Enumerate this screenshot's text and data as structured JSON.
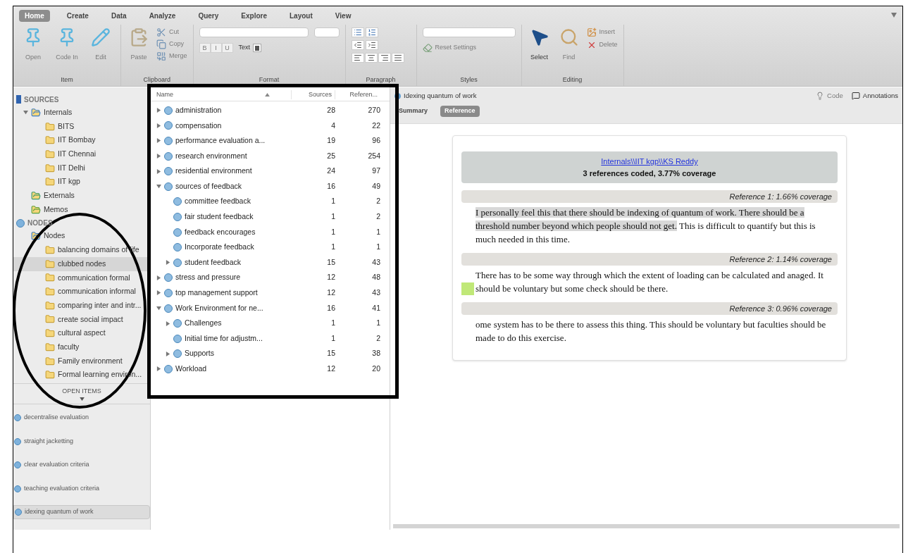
{
  "ribbon": {
    "tabs": [
      {
        "label": "Home",
        "selected": true
      },
      {
        "label": "Create",
        "selected": false
      },
      {
        "label": "Data",
        "selected": false
      },
      {
        "label": "Analyze",
        "selected": false
      },
      {
        "label": "Query",
        "selected": false
      },
      {
        "label": "Explore",
        "selected": false
      },
      {
        "label": "Layout",
        "selected": false
      },
      {
        "label": "View",
        "selected": false
      }
    ],
    "groups": [
      {
        "kind": "item",
        "label": "Item",
        "tools": [
          {
            "label": "Open",
            "disabled": true
          },
          {
            "label": "Code In",
            "disabled": true
          },
          {
            "label": "Edit",
            "disabled": true
          }
        ]
      },
      {
        "kind": "clipboard",
        "label": "Clipboard",
        "tools": [
          {
            "label": "Paste",
            "disabled": true
          },
          {
            "label": "Cut",
            "disabled": true
          },
          {
            "label": "Copy",
            "disabled": true
          },
          {
            "label": "Merge",
            "disabled": true
          }
        ]
      },
      {
        "kind": "format",
        "label": "Format",
        "tools": [
          {
            "label": "B",
            "disabled": true
          },
          {
            "label": "I",
            "disabled": true
          },
          {
            "label": "U",
            "disabled": true
          },
          {
            "label": "Text",
            "disabled": false
          }
        ]
      },
      {
        "kind": "paragraph",
        "label": "Paragraph"
      },
      {
        "kind": "styles",
        "label": "Styles",
        "tools": [
          {
            "label": "Reset Settings",
            "disabled": true
          }
        ]
      },
      {
        "kind": "editing",
        "label": "Editing",
        "tools": [
          {
            "label": "Select",
            "disabled": false
          },
          {
            "label": "Find",
            "disabled": true
          },
          {
            "label": "Insert",
            "disabled": true
          },
          {
            "label": "Delete",
            "disabled": true
          }
        ]
      }
    ]
  },
  "sidebar": {
    "sections": [
      {
        "kind": "sources",
        "title": "SOURCES",
        "items": [
          {
            "kind": "internals",
            "label": "Internals",
            "selected": false,
            "expanded": true,
            "children": [
              {
                "kind": "folder",
                "label": "BITS",
                "selected": false
              },
              {
                "kind": "folder",
                "label": "IIT Bombay",
                "selected": false
              },
              {
                "kind": "folder",
                "label": "IIT Chennai",
                "selected": false
              },
              {
                "kind": "folder",
                "label": "IIT Delhi",
                "selected": false
              },
              {
                "kind": "folder",
                "label": "IIT kgp",
                "selected": false
              }
            ]
          },
          {
            "kind": "externals",
            "label": "Externals",
            "selected": false
          },
          {
            "kind": "memos",
            "label": "Memos",
            "selected": false
          }
        ]
      },
      {
        "kind": "nodes",
        "title": "NODES",
        "items": [
          {
            "kind": "nodes",
            "label": "Nodes",
            "selected": false,
            "children": [
              {
                "kind": "folder",
                "label": "balancing domains of life",
                "selected": false
              },
              {
                "kind": "folder",
                "label": "clubbed nodes",
                "selected": true
              },
              {
                "kind": "folder",
                "label": "communication formal",
                "selected": false
              },
              {
                "kind": "folder",
                "label": "communication informal",
                "selected": false
              },
              {
                "kind": "folder",
                "label": "comparing inter and intr...",
                "selected": false
              },
              {
                "kind": "folder",
                "label": "create social impact",
                "selected": false
              },
              {
                "kind": "folder",
                "label": "cultural aspect",
                "selected": false
              },
              {
                "kind": "folder",
                "label": "faculty",
                "selected": false
              },
              {
                "kind": "folder",
                "label": "Family environment",
                "selected": false
              },
              {
                "kind": "folder",
                "label": "Formal learning environ...",
                "selected": false
              }
            ]
          }
        ]
      }
    ],
    "open_items_label": "OPEN ITEMS",
    "open_items": [
      {
        "label": "decentralise evaluation",
        "selected": false
      },
      {
        "label": "straight jacketting",
        "selected": false
      },
      {
        "label": "clear evaluation criteria",
        "selected": false
      },
      {
        "label": "teaching evaluation criteria",
        "selected": false
      },
      {
        "label": "idexing quantum of work",
        "selected": true
      }
    ]
  },
  "node_list": {
    "columns": [
      "Name",
      "Sources",
      "Referen..."
    ],
    "rows": [
      {
        "name": "administration",
        "sources": "28",
        "references": "270",
        "expanded": false
      },
      {
        "name": "compensation",
        "sources": "4",
        "references": "22",
        "expanded": false
      },
      {
        "name": "performance evaluation a...",
        "sources": "19",
        "references": "96",
        "expanded": false
      },
      {
        "name": "research environment",
        "sources": "25",
        "references": "254",
        "expanded": false
      },
      {
        "name": "residential environment",
        "sources": "24",
        "references": "97",
        "expanded": false
      },
      {
        "name": "sources of feedback",
        "sources": "16",
        "references": "49",
        "expanded": true,
        "children": [
          {
            "name": "committee feedback",
            "sources": "1",
            "references": "2"
          },
          {
            "name": "fair student feedback",
            "sources": "1",
            "references": "2"
          },
          {
            "name": "feedback encourages",
            "sources": "1",
            "references": "1"
          },
          {
            "name": "Incorporate feedback",
            "sources": "1",
            "references": "1"
          },
          {
            "name": "student feedback",
            "sources": "15",
            "references": "43",
            "expanded": false
          }
        ]
      },
      {
        "name": "stress and pressure",
        "sources": "12",
        "references": "48",
        "expanded": false
      },
      {
        "name": "top management support",
        "sources": "12",
        "references": "43",
        "expanded": false
      },
      {
        "name": "Work Environment for ne...",
        "sources": "16",
        "references": "41",
        "expanded": true,
        "children": [
          {
            "name": "Challenges",
            "sources": "1",
            "references": "1",
            "expanded": false
          },
          {
            "name": "Initial time for adjustm...",
            "sources": "1",
            "references": "2"
          },
          {
            "name": "Supports",
            "sources": "15",
            "references": "38",
            "expanded": false
          }
        ]
      },
      {
        "name": "Workload",
        "sources": "12",
        "references": "20",
        "expanded": false
      }
    ]
  },
  "detail": {
    "title": "Idexing quantum of work",
    "actions": [
      {
        "label": "Code",
        "disabled": true
      },
      {
        "label": "Annotations",
        "disabled": false
      }
    ],
    "tabs": [
      {
        "label": "Summary",
        "selected": false
      },
      {
        "label": "Reference",
        "selected": true
      }
    ],
    "source_link": "Internals\\\\IIT kgp\\\\KS Reddy",
    "summary": "3 references coded, 3.77% coverage",
    "references": [
      {
        "heading": "Reference 1: 1.66% coverage",
        "highlighted": "I personally feel this that there should be indexing of quantum of work. There should be a threshold number beyond which people should not get.",
        "text": " This is difficult to quantify but this is much needed in this time.",
        "marker": false
      },
      {
        "heading": "Reference 2: 1.14% coverage",
        "text": "There has to be some way through which the extent of loading can be calculated and anaged. It should be voluntary but some check should be there.",
        "marker": true
      },
      {
        "heading": "Reference 3: 0.96% coverage",
        "text": "ome system has to be there to assess this thing. This should be voluntary but faculties should be made to do this exercise.",
        "marker": false
      }
    ]
  }
}
